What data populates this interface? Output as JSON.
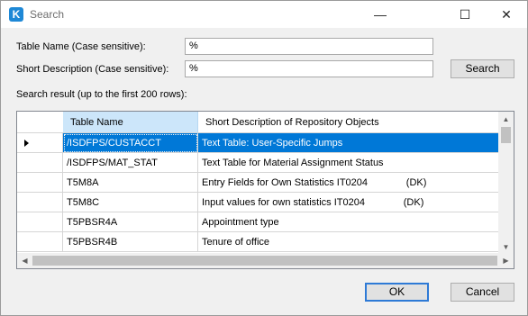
{
  "window": {
    "title": "Search",
    "app_icon_letter": "K",
    "minimize": "—",
    "maximize": "☐",
    "close": "✕"
  },
  "form": {
    "table_name_label": "Table Name (Case sensitive):",
    "table_name_value": "%",
    "short_desc_label": "Short Description (Case sensitive):",
    "short_desc_value": "%",
    "search_button": "Search",
    "result_label": "Search result (up to the first 200 rows):"
  },
  "grid": {
    "columns": [
      "Table Name",
      "Short Description of Repository Objects"
    ],
    "rows": [
      {
        "name": "/ISDFPS/CUSTACCT",
        "desc": "Text Table: User-Specific Jumps",
        "selected": true
      },
      {
        "name": "/ISDFPS/MAT_STAT",
        "desc": "Text Table for Material Assignment Status",
        "selected": false
      },
      {
        "name": "T5M8A",
        "desc": "Entry Fields for Own Statistics IT0204              (DK)",
        "selected": false
      },
      {
        "name": "T5M8C",
        "desc": "Input values for own statistics IT0204              (DK)",
        "selected": false
      },
      {
        "name": "T5PBSR4A",
        "desc": "Appointment type",
        "selected": false
      },
      {
        "name": "T5PBSR4B",
        "desc": "Tenure of office",
        "selected": false
      }
    ]
  },
  "footer": {
    "ok_button": "OK",
    "cancel_button": "Cancel"
  }
}
